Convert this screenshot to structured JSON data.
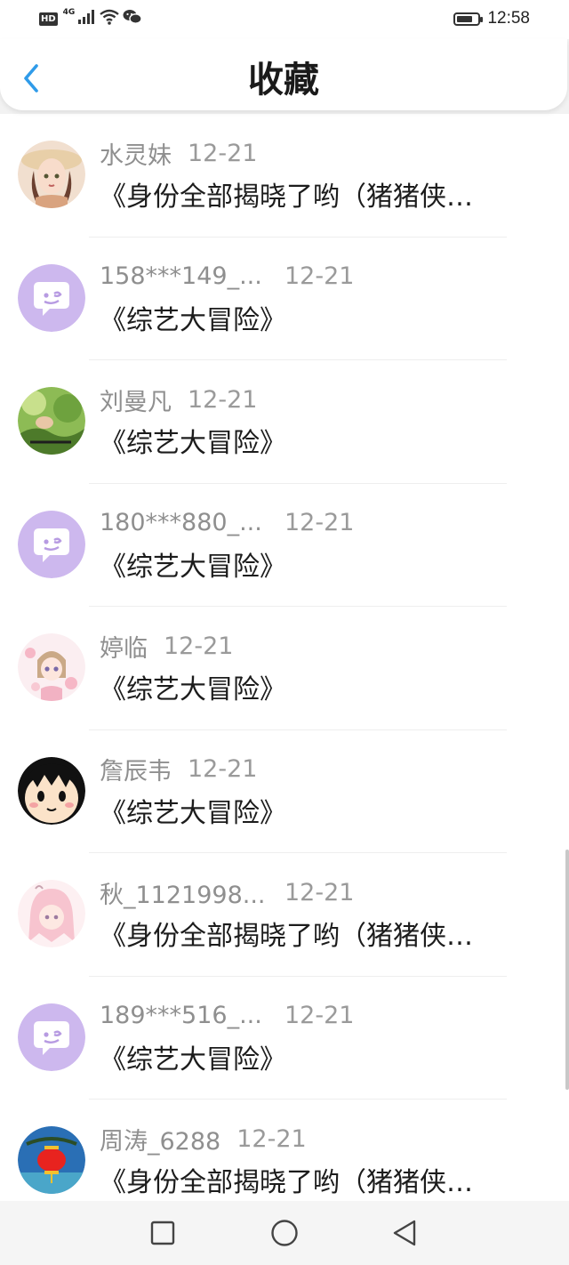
{
  "status_bar": {
    "hd_label": "HD",
    "network_label": "4G",
    "time": "12:58",
    "battery_level": 0.75
  },
  "header": {
    "title": "收藏",
    "back_icon": "chevron-left-icon",
    "accent_color": "#2f9be9"
  },
  "items": [
    {
      "name": "水灵妹",
      "date": "12-21",
      "text": "《身份全部揭晓了哟（猪猪侠…",
      "avatar": "anime-girl-hat"
    },
    {
      "name": "158***149_...",
      "date": "12-21",
      "text": "《综艺大冒险》",
      "avatar": "default-chat"
    },
    {
      "name": "刘曼凡",
      "date": "12-21",
      "text": "《综艺大冒险》",
      "avatar": "grass-photo"
    },
    {
      "name": "180***880_...",
      "date": "12-21",
      "text": "《综艺大冒险》",
      "avatar": "default-chat"
    },
    {
      "name": "婷临",
      "date": "12-21",
      "text": "《综艺大冒险》",
      "avatar": "anime-girl-flowers"
    },
    {
      "name": "詹辰韦",
      "date": "12-21",
      "text": "《综艺大冒险》",
      "avatar": "cartoon-face"
    },
    {
      "name": "秋_1121998...",
      "date": "12-21",
      "text": "《身份全部揭晓了哟（猪猪侠…",
      "avatar": "anime-girl-pink"
    },
    {
      "name": "189***516_...",
      "date": "12-21",
      "text": "《综艺大冒险》",
      "avatar": "default-chat"
    },
    {
      "name": "周涛_6288",
      "date": "12-21",
      "text": "《身份全部揭晓了哟（猪猪侠…",
      "avatar": "lantern-photo"
    }
  ],
  "nav_bar": {
    "recents_icon": "square-icon",
    "home_icon": "circle-icon",
    "back_icon": "triangle-back-icon"
  }
}
